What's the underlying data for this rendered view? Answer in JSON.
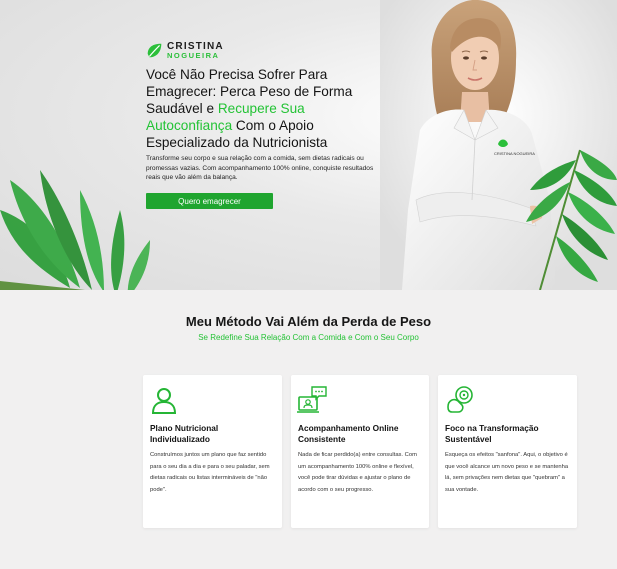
{
  "brand": {
    "name": "CRISTINA",
    "sub": "NOGUEIRA",
    "accent_color": "#23c335"
  },
  "hero": {
    "title_part1": "Você Não Precisa Sofrer Para Emagrecer: Perca Peso de Forma Saudável e ",
    "title_accent": "Recupere Sua Autoconfiança",
    "title_part2": " Com o Apoio Especializado da Nutricionista",
    "description": "Transforme seu corpo e sua relação com a comida, sem dietas radicais ou promessas vazias. Com acompanhamento 100% online, conquiste resultados reais que vão além da balança.",
    "cta_label": "Quero emagrecer",
    "coat_logo": "CRISTINA NOGUEIRA"
  },
  "method": {
    "title": "Meu Método Vai Além da Perda de Peso",
    "subtitle": "Se Redefine Sua Relação Com a Comida e Com o Seu Corpo"
  },
  "cards": [
    {
      "icon": "user-icon",
      "title": "Plano Nutricional Individualizado",
      "text": "Construímos juntos um plano que faz sentido para o seu dia a dia e para o seu paladar, sem dietas radicais ou listas intermináveis de \"não pode\"."
    },
    {
      "icon": "online-consultation-icon",
      "title": "Acompanhamento Online Consistente",
      "text": "Nada de ficar perdido(a) entre consultas. Com um acompanhamento 100% online e flexível, você pode tirar dúvidas e ajustar o plano de acordo com o seu progresso."
    },
    {
      "icon": "target-strength-icon",
      "title": "Foco na Transformação Sustentável",
      "text": "Esqueça os efeitos \"sanfona\". Aqui, o objetivo é que você alcance um novo peso e se mantenha lá, sem privações nem dietas que \"quebram\" a sua vontade."
    }
  ]
}
